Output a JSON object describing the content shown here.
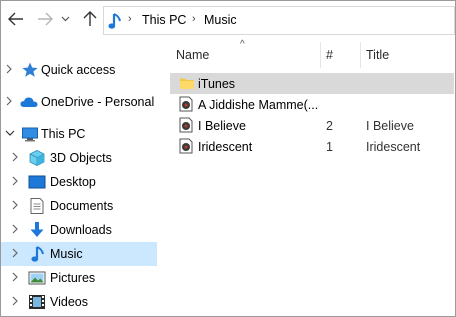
{
  "address": {
    "crumbs": [
      "This PC",
      "Music"
    ]
  },
  "nav": {
    "items": [
      {
        "label": "Quick access",
        "icon": "star-icon"
      },
      {
        "label": "OneDrive - Personal",
        "icon": "cloud-icon"
      },
      {
        "label": "This PC",
        "icon": "computer-icon"
      },
      {
        "label": "3D Objects",
        "icon": "cube-icon"
      },
      {
        "label": "Desktop",
        "icon": "desktop-icon"
      },
      {
        "label": "Documents",
        "icon": "document-icon"
      },
      {
        "label": "Downloads",
        "icon": "download-icon"
      },
      {
        "label": "Music",
        "icon": "music-note-icon"
      },
      {
        "label": "Pictures",
        "icon": "picture-icon"
      },
      {
        "label": "Videos",
        "icon": "video-icon"
      }
    ]
  },
  "columns": {
    "name": "Name",
    "number": "#",
    "title": "Title"
  },
  "files": [
    {
      "name": "iTunes",
      "number": "",
      "title": "",
      "kind": "folder"
    },
    {
      "name": "A Jiddishe Mamme(...",
      "number": "",
      "title": "",
      "kind": "audio"
    },
    {
      "name": "I Believe",
      "number": "2",
      "title": "I Believe",
      "kind": "audio"
    },
    {
      "name": "Iridescent",
      "number": "1",
      "title": "Iridescent",
      "kind": "audio"
    }
  ],
  "colors": {
    "selected_bg": "#cce8ff",
    "hover_bg": "#d9d9d9",
    "accent_blue": "#1e78d7",
    "folder_yellow": "#f3c94a"
  }
}
